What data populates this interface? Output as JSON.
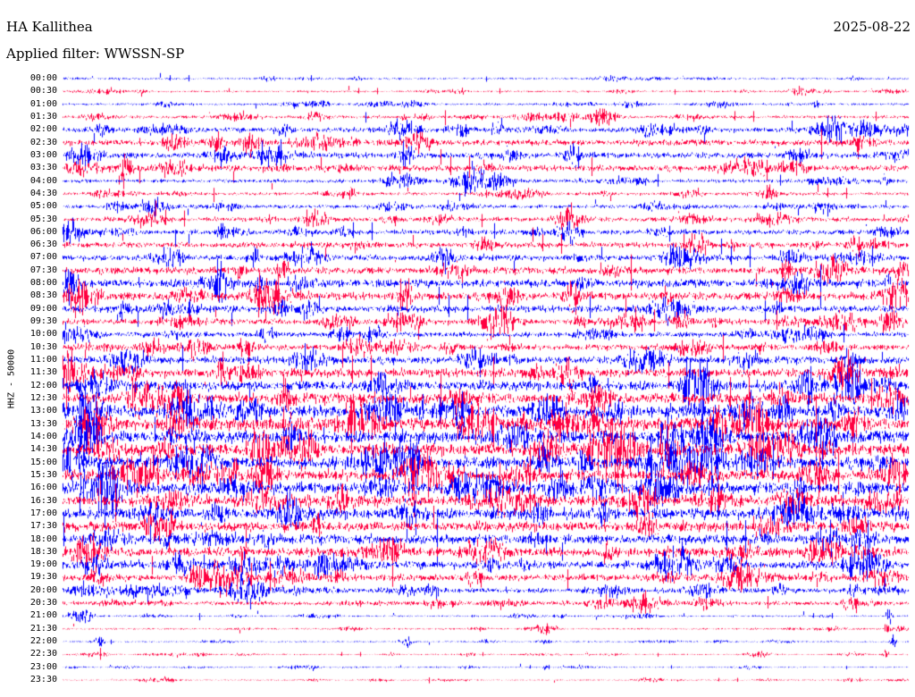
{
  "header": {
    "station": "HA Kallithea",
    "date": "2025-08-22",
    "filter": "Applied filter: WWSSN-SP"
  },
  "channel_label": "HHZ - 50000",
  "colors": {
    "trace_even": "#0000ff",
    "trace_odd": "#ff0040",
    "background": "#ffffff",
    "text": "#000000"
  },
  "chart_data": {
    "type": "line",
    "title": "HA Kallithea",
    "subtitle": "Applied filter: WWSSN-SP",
    "date": "2025-08-22",
    "ylabel": "HHZ - 50000",
    "xlabel": "",
    "legend": "none",
    "grid": false,
    "row_labels": [
      "00:00",
      "00:30",
      "01:00",
      "01:30",
      "02:00",
      "02:30",
      "03:00",
      "03:30",
      "04:00",
      "04:30",
      "05:00",
      "05:30",
      "06:00",
      "06:30",
      "07:00",
      "07:30",
      "08:00",
      "08:30",
      "09:00",
      "09:30",
      "10:00",
      "10:30",
      "11:00",
      "11:30",
      "12:00",
      "12:30",
      "13:00",
      "13:30",
      "14:00",
      "14:30",
      "15:00",
      "15:30",
      "16:00",
      "16:30",
      "17:00",
      "17:30",
      "18:00",
      "18:30",
      "19:00",
      "19:30",
      "20:00",
      "20:30",
      "21:00",
      "21:30",
      "22:00",
      "22:30",
      "23:00",
      "23:30"
    ],
    "row_interval_minutes": 30,
    "row_colors": [
      "#0000ff",
      "#ff0040"
    ],
    "relative_noise_amplitude": [
      0.35,
      0.35,
      0.4,
      0.6,
      1.0,
      1.2,
      1.2,
      1.2,
      0.7,
      0.6,
      0.7,
      0.9,
      1.0,
      1.1,
      1.2,
      1.4,
      1.6,
      1.6,
      1.4,
      1.2,
      1.0,
      1.1,
      1.5,
      1.8,
      2.0,
      2.2,
      2.4,
      2.5,
      2.5,
      2.5,
      2.4,
      2.3,
      2.3,
      2.2,
      2.2,
      2.0,
      1.9,
      1.8,
      1.6,
      1.4,
      1.0,
      0.8,
      0.3,
      0.3,
      0.25,
      0.25,
      0.22,
      0.22
    ],
    "events": [
      {
        "row": 42,
        "position": 0.03,
        "amplitude": 6
      },
      {
        "row": 44,
        "position": 0.045,
        "amplitude": 7
      },
      {
        "row": 44,
        "position": 0.41,
        "amplitude": 8
      },
      {
        "row": 45,
        "position": 0.13,
        "amplitude": 4
      },
      {
        "row": 45,
        "position": 0.62,
        "amplitude": 4
      },
      {
        "row": 46,
        "position": 0.57,
        "amplitude": 5
      },
      {
        "row": 42,
        "position": 0.977,
        "amplitude": 14
      },
      {
        "row": 43,
        "position": 0.975,
        "amplitude": 12
      },
      {
        "row": 44,
        "position": 0.982,
        "amplitude": 10
      },
      {
        "row": 45,
        "position": 0.973,
        "amplitude": 9
      }
    ]
  }
}
